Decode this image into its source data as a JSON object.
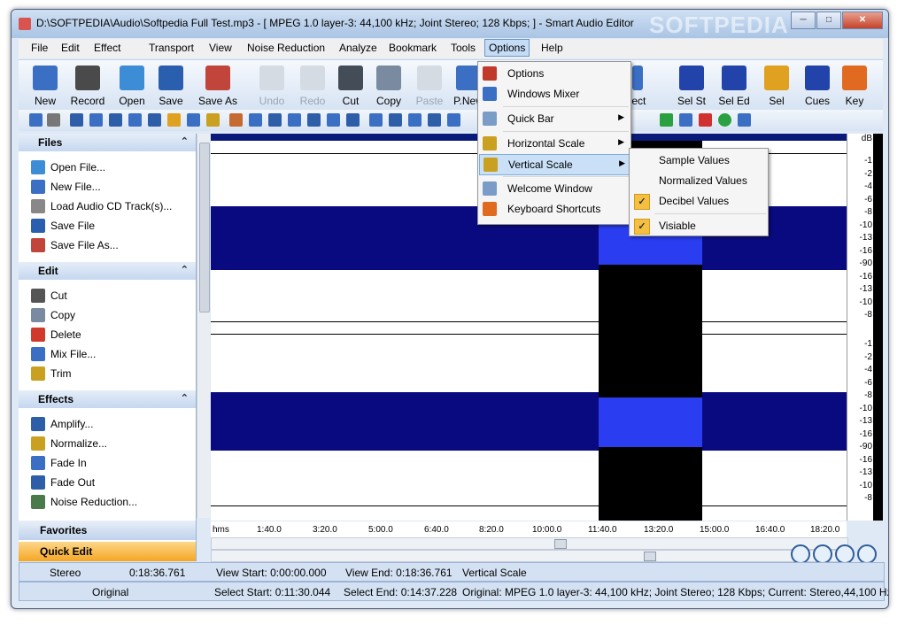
{
  "window": {
    "title": "D:\\SOFTPEDIA\\Audio\\Softpedia Full Test.mp3 - [ MPEG 1.0 layer-3: 44,100 kHz; Joint Stereo; 128 Kbps;  ] - Smart Audio Editor",
    "watermark": "SOFTPEDIA",
    "minimize": "─",
    "maximize": "□",
    "close": "✕"
  },
  "menubar": [
    {
      "label": "File"
    },
    {
      "label": "Edit"
    },
    {
      "label": "Effect"
    },
    {
      "label": "Transport"
    },
    {
      "label": "View"
    },
    {
      "label": "Noise Reduction"
    },
    {
      "label": "Analyze"
    },
    {
      "label": "Bookmark"
    },
    {
      "label": "Tools"
    },
    {
      "label": "Options"
    },
    {
      "label": "Help"
    }
  ],
  "toolbar": [
    {
      "label": "New",
      "icon": "new-file-icon",
      "color": "#3b6fc4"
    },
    {
      "label": "Record",
      "icon": "microphone-icon",
      "color": "#4a4a4a"
    },
    {
      "label": "Open",
      "icon": "open-folder-icon",
      "color": "#3d8dd6"
    },
    {
      "label": "Save",
      "icon": "save-disk-icon",
      "color": "#2a5fb0"
    },
    {
      "label": "Save As",
      "icon": "save-as-icon",
      "color": "#c2453b"
    },
    {
      "label": "Undo",
      "icon": "undo-icon",
      "color": "#b5bcc6"
    },
    {
      "label": "Redo",
      "icon": "redo-icon",
      "color": "#b5bcc6"
    },
    {
      "label": "Cut",
      "icon": "scissors-icon",
      "color": "#444c58"
    },
    {
      "label": "Copy",
      "icon": "copy-icon",
      "color": "#7a8aa0"
    },
    {
      "label": "Paste",
      "icon": "paste-icon",
      "color": "#b5bcc6"
    },
    {
      "label": "P.New",
      "icon": "paste-new-icon",
      "color": "#3b6fc4"
    },
    {
      "label": "lect",
      "icon": "select-icon",
      "color": "#3b6fc4"
    },
    {
      "label": "Sel St",
      "icon": "selection-start-icon",
      "color": "#2244aa"
    },
    {
      "label": "Sel Ed",
      "icon": "selection-end-icon",
      "color": "#2244aa"
    },
    {
      "label": "Sel",
      "icon": "selection-icon",
      "color": "#e0a020"
    },
    {
      "label": "Cues",
      "icon": "cues-icon",
      "color": "#2244aa"
    },
    {
      "label": "Key",
      "icon": "key-icon",
      "color": "#e06a20"
    }
  ],
  "panel": {
    "sections": [
      {
        "title": "Files",
        "collapse": "⌃",
        "items": [
          "Open File...",
          "New File...",
          "Load Audio CD Track(s)...",
          "Save File",
          "Save File As..."
        ]
      },
      {
        "title": "Edit",
        "collapse": "⌃",
        "items": [
          "Cut",
          "Copy",
          "Delete",
          "Mix File...",
          "Trim"
        ]
      },
      {
        "title": "Effects",
        "collapse": "⌃",
        "items": [
          "Amplify...",
          "Normalize...",
          "Fade In",
          "Fade Out",
          "Noise Reduction..."
        ]
      }
    ],
    "favorites": "Favorites",
    "quick_edit": "Quick Edit"
  },
  "db_scale": {
    "unit": "dB",
    "labels": [
      "-1",
      "-2",
      "-4",
      "-6",
      "-8",
      "-10",
      "-13",
      "-16",
      "-90",
      "-16",
      "-13",
      "-10",
      "-8",
      "-6",
      "-4",
      "-2",
      "-1"
    ]
  },
  "timeline": {
    "labels": [
      "hms",
      "1:40.0",
      "3:20.0",
      "5:00.0",
      "6:40.0",
      "8:20.0",
      "10:00.0",
      "11:40.0",
      "13:20.0",
      "15:00.0",
      "16:40.0",
      "18:20.0"
    ]
  },
  "options_menu": [
    {
      "label": "Options",
      "submenu": false
    },
    {
      "label": "Windows Mixer",
      "submenu": false
    },
    {
      "label": "Quick Bar",
      "submenu": true
    },
    {
      "label": "Horizontal Scale",
      "submenu": true
    },
    {
      "label": "Vertical Scale",
      "submenu": true
    },
    {
      "label": "Welcome Window",
      "submenu": false
    },
    {
      "label": "Keyboard Shortcuts",
      "submenu": false
    }
  ],
  "vertical_scale_submenu": [
    {
      "label": "Sample Values",
      "checked": false
    },
    {
      "label": "Normalized Values",
      "checked": false
    },
    {
      "label": "Decibel Values",
      "checked": true
    },
    {
      "label": "Visiable",
      "checked": true
    }
  ],
  "status": {
    "row1": {
      "channel": "Stereo",
      "duration": "0:18:36.761",
      "view_start": "View Start: 0:00:00.000",
      "view_end": "View End: 0:18:36.761",
      "scale": "Vertical Scale"
    },
    "row2": {
      "mode": "Original",
      "select_start": "Select Start: 0:11:30.044",
      "select_end": "Select End: 0:14:37.228",
      "info": "Original: MPEG 1.0 layer-3: 44,100 kHz; Joint Stereo; 128 Kbps;  Current: Stereo,44,100 Hz"
    }
  },
  "colors": {
    "waveform": "#0a0a80",
    "selection_bg": "#000000",
    "selection_wave": "#2a3df0",
    "panel_header": "#c5d7ef",
    "quick_edit": "#f5a623"
  }
}
